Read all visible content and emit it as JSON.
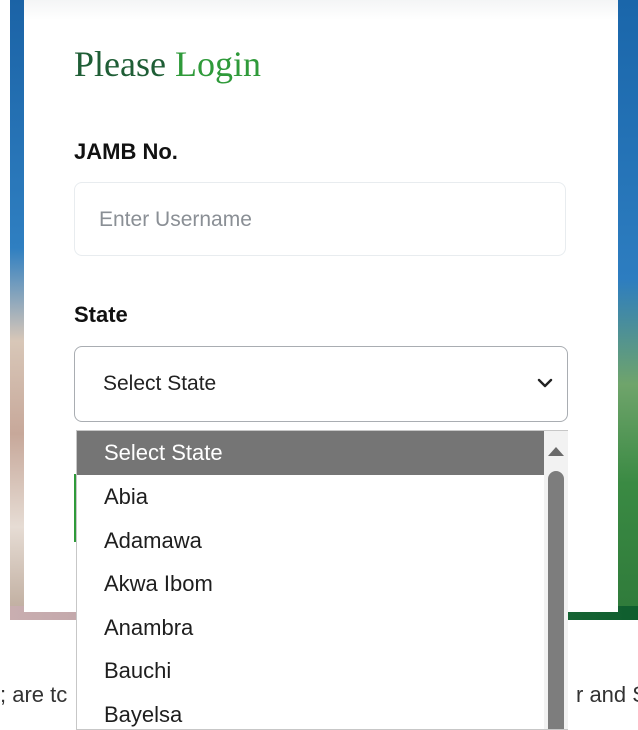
{
  "login": {
    "title_part1": "Please",
    "title_part2": "Login",
    "jamb_label": "JAMB No.",
    "username_placeholder": "Enter Username",
    "state_label": "State",
    "state_selected": "Select State"
  },
  "state_dropdown": {
    "options": [
      "Select State",
      "Abia",
      "Adamawa",
      "Akwa Ibom",
      "Anambra",
      "Bauchi",
      "Bayelsa"
    ]
  },
  "footer": {
    "left_fragment": "; are tc",
    "right_fragment": "r and S"
  },
  "colors": {
    "title_dark": "#1f5e36",
    "title_accent": "#2f9a3a",
    "selected_option_bg": "#757575"
  }
}
